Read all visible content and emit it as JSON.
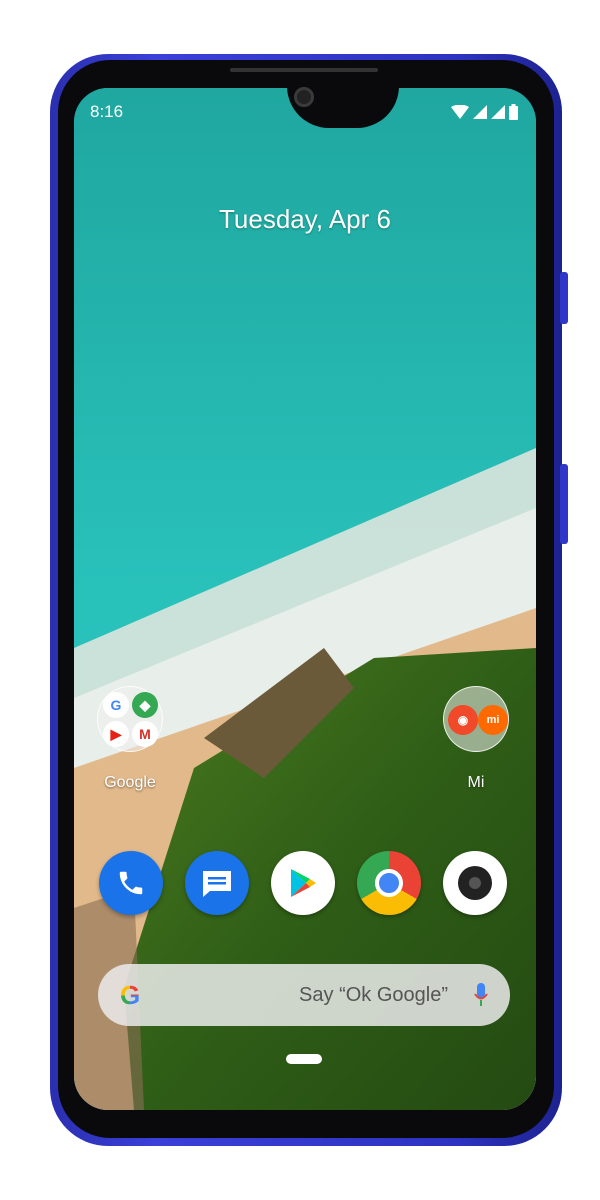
{
  "status_bar": {
    "time": "8:16",
    "icons": [
      "wifi-icon",
      "signal-icon",
      "signal-icon",
      "battery-icon"
    ]
  },
  "lock_date": "Tuesday, Apr 6",
  "folders": [
    {
      "label": "Google",
      "apps": [
        "google-icon",
        "maps-icon",
        "youtube-icon",
        "gmail-icon"
      ]
    },
    {
      "label": "Mi",
      "apps": [
        "mi-community-icon",
        "mi-store-icon"
      ]
    }
  ],
  "dock": [
    "phone",
    "messages",
    "play-store",
    "chrome",
    "camera"
  ],
  "search": {
    "placeholder": "Say “Ok Google”"
  },
  "colors": {
    "frame": "#2c33c0",
    "google_blue": "#1a73e8",
    "teal": "#1aa9a4"
  }
}
